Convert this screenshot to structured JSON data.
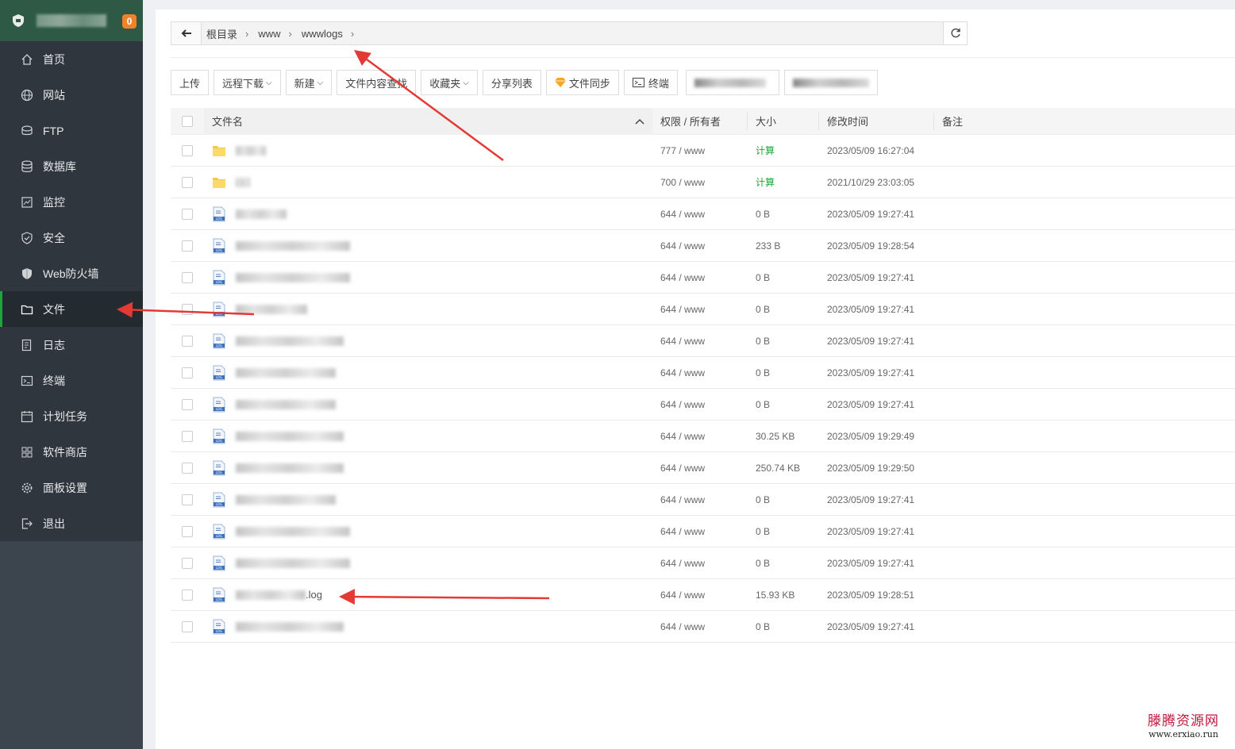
{
  "sidebar": {
    "badge": "0",
    "items": [
      {
        "label": "首页",
        "icon": "home-icon"
      },
      {
        "label": "网站",
        "icon": "globe-icon"
      },
      {
        "label": "FTP",
        "icon": "ftp-icon"
      },
      {
        "label": "数据库",
        "icon": "database-icon"
      },
      {
        "label": "监控",
        "icon": "monitor-icon"
      },
      {
        "label": "安全",
        "icon": "shield-check-icon"
      },
      {
        "label": "Web防火墙",
        "icon": "firewall-shield-icon"
      },
      {
        "label": "文件",
        "icon": "folder-icon",
        "active": true
      },
      {
        "label": "日志",
        "icon": "log-icon"
      },
      {
        "label": "终端",
        "icon": "terminal-icon"
      },
      {
        "label": "计划任务",
        "icon": "calendar-icon"
      },
      {
        "label": "软件商店",
        "icon": "apps-grid-icon"
      },
      {
        "label": "面板设置",
        "icon": "gear-icon"
      },
      {
        "label": "退出",
        "icon": "logout-icon"
      }
    ]
  },
  "path": {
    "crumbs": [
      "根目录",
      "www",
      "wwwlogs"
    ]
  },
  "toolbar": {
    "upload": "上传",
    "remote_download": "远程下载",
    "new": "新建",
    "search_content": "文件内容查找",
    "favorites": "收藏夹",
    "share_list": "分享列表",
    "file_sync": "文件同步",
    "terminal": "终端"
  },
  "table": {
    "headers": {
      "name": "文件名",
      "perm": "权限 / 所有者",
      "size": "大小",
      "time": "修改时间",
      "note": "备注"
    },
    "rows": [
      {
        "type": "folder",
        "perm": "777 / www",
        "size": "计算",
        "time": "2023/05/09 16:27:04",
        "blur": 38
      },
      {
        "type": "folder",
        "perm": "700 / www",
        "size": "计算",
        "time": "2021/10/29 23:03:05",
        "blur": 18
      },
      {
        "type": "log",
        "perm": "644 / www",
        "size": "0 B",
        "time": "2023/05/09 19:27:41",
        "blur": 64
      },
      {
        "type": "log",
        "perm": "644 / www",
        "size": "233 B",
        "time": "2023/05/09 19:28:54",
        "blur": 144
      },
      {
        "type": "log",
        "perm": "644 / www",
        "size": "0 B",
        "time": "2023/05/09 19:27:41",
        "blur": 144
      },
      {
        "type": "log",
        "perm": "644 / www",
        "size": "0 B",
        "time": "2023/05/09 19:27:41",
        "blur": 90
      },
      {
        "type": "log",
        "perm": "644 / www",
        "size": "0 B",
        "time": "2023/05/09 19:27:41",
        "blur": 136
      },
      {
        "type": "log",
        "perm": "644 / www",
        "size": "0 B",
        "time": "2023/05/09 19:27:41",
        "blur": 126
      },
      {
        "type": "log",
        "perm": "644 / www",
        "size": "0 B",
        "time": "2023/05/09 19:27:41",
        "blur": 126
      },
      {
        "type": "log",
        "perm": "644 / www",
        "size": "30.25 KB",
        "time": "2023/05/09 19:29:49",
        "blur": 136
      },
      {
        "type": "log",
        "perm": "644 / www",
        "size": "250.74 KB",
        "time": "2023/05/09 19:29:50",
        "blur": 136
      },
      {
        "type": "log",
        "perm": "644 / www",
        "size": "0 B",
        "time": "2023/05/09 19:27:41",
        "blur": 126
      },
      {
        "type": "log",
        "perm": "644 / www",
        "size": "0 B",
        "time": "2023/05/09 19:27:41",
        "blur": 144
      },
      {
        "type": "log",
        "perm": "644 / www",
        "size": "0 B",
        "time": "2023/05/09 19:27:41",
        "blur": 144
      },
      {
        "type": "log",
        "perm": "644 / www",
        "size": "15.93 KB",
        "time": "2023/05/09 19:28:51",
        "blur": 88,
        "suffix": ".log"
      },
      {
        "type": "log",
        "perm": "644 / www",
        "size": "0 B",
        "time": "2023/05/09 19:27:41",
        "blur": 136
      }
    ]
  },
  "watermark": {
    "cn": "滕腾资源网",
    "url": "www.erxiao.run"
  },
  "colors": {
    "sidebar_bg": "#2f363d",
    "header_bg": "#2e5a45",
    "accent_green": "#20a53a",
    "badge_orange": "#f0822c",
    "arrow_red": "#e53935"
  }
}
